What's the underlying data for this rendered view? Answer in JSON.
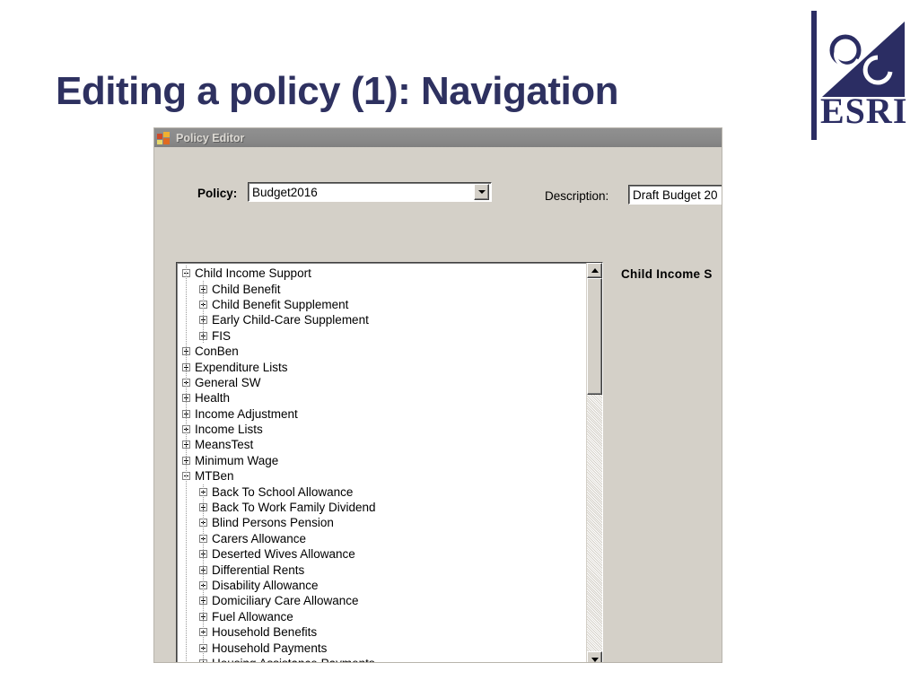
{
  "slide": {
    "title": "Editing a policy (1): Navigation",
    "title_color": "#2e3160",
    "background_color": "#ffffff"
  },
  "logo": {
    "name": "esri-logo",
    "wordmark": "ESRI",
    "color": "#2b2d63"
  },
  "window": {
    "title": "Policy Editor",
    "icon": "application-icon",
    "titlebar_color": "#8a8a8a",
    "face_color": "#d4d0c8"
  },
  "form": {
    "policy_label": "Policy:",
    "policy_value": "Budget2016",
    "policy_dropdown_icon": "chevron-down-icon",
    "description_label": "Description:",
    "description_value": "Draft Budget 20"
  },
  "detail_pane": {
    "heading": "Child Income S"
  },
  "scrollbar": {
    "up_icon": "triangle-up-icon",
    "down_icon": "triangle-down-icon",
    "thumb_position": "top"
  },
  "tree": {
    "items": [
      {
        "label": "Child Income Support",
        "level": 0,
        "state": "expanded"
      },
      {
        "label": "Child Benefit",
        "level": 1,
        "state": "collapsed"
      },
      {
        "label": "Child Benefit Supplement",
        "level": 1,
        "state": "collapsed"
      },
      {
        "label": "Early Child-Care Supplement",
        "level": 1,
        "state": "collapsed"
      },
      {
        "label": "FIS",
        "level": 1,
        "state": "collapsed"
      },
      {
        "label": "ConBen",
        "level": 0,
        "state": "collapsed"
      },
      {
        "label": "Expenditure Lists",
        "level": 0,
        "state": "collapsed"
      },
      {
        "label": "General SW",
        "level": 0,
        "state": "collapsed"
      },
      {
        "label": "Health",
        "level": 0,
        "state": "collapsed"
      },
      {
        "label": "Income Adjustment",
        "level": 0,
        "state": "collapsed"
      },
      {
        "label": "Income Lists",
        "level": 0,
        "state": "collapsed"
      },
      {
        "label": "MeansTest",
        "level": 0,
        "state": "collapsed"
      },
      {
        "label": "Minimum Wage",
        "level": 0,
        "state": "collapsed"
      },
      {
        "label": "MTBen",
        "level": 0,
        "state": "expanded"
      },
      {
        "label": "Back To School Allowance",
        "level": 1,
        "state": "collapsed"
      },
      {
        "label": "Back To Work Family Dividend",
        "level": 1,
        "state": "collapsed"
      },
      {
        "label": "Blind Persons Pension",
        "level": 1,
        "state": "collapsed"
      },
      {
        "label": "Carers Allowance",
        "level": 1,
        "state": "collapsed"
      },
      {
        "label": "Deserted Wives Allowance",
        "level": 1,
        "state": "collapsed"
      },
      {
        "label": "Differential Rents",
        "level": 1,
        "state": "collapsed"
      },
      {
        "label": "Disability Allowance",
        "level": 1,
        "state": "collapsed"
      },
      {
        "label": "Domiciliary Care Allowance",
        "level": 1,
        "state": "collapsed"
      },
      {
        "label": "Fuel Allowance",
        "level": 1,
        "state": "collapsed"
      },
      {
        "label": "Household Benefits",
        "level": 1,
        "state": "collapsed"
      },
      {
        "label": "Household Payments",
        "level": 1,
        "state": "collapsed"
      },
      {
        "label": "Housing Assistance Payments",
        "level": 1,
        "state": "collapsed"
      }
    ]
  }
}
